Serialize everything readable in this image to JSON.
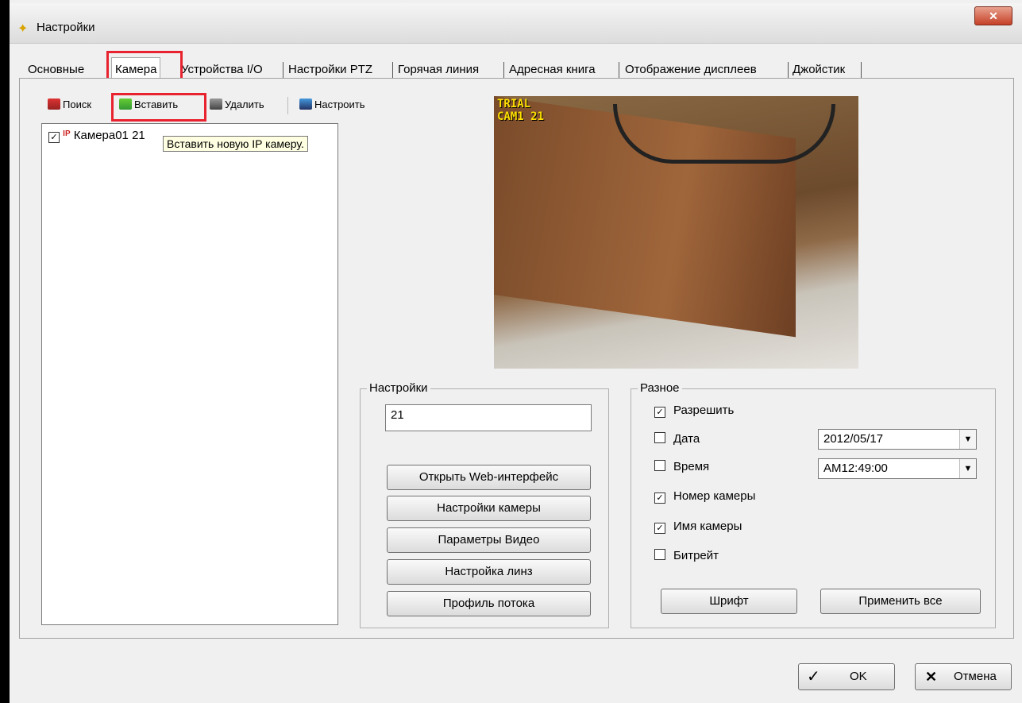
{
  "window": {
    "title": "Настройки"
  },
  "tabs": [
    {
      "label": "Основные"
    },
    {
      "label": "Камера"
    },
    {
      "label": "Устройства I/O"
    },
    {
      "label": "Настройки PTZ"
    },
    {
      "label": "Горячая линия"
    },
    {
      "label": "Адресная книга"
    },
    {
      "label": "Отображение дисплеев"
    },
    {
      "label": "Джойстик"
    }
  ],
  "toolbar": {
    "search_label": "Поиск",
    "insert_label": "Вставить",
    "delete_label": "Удалить",
    "configure_label": "Настроить"
  },
  "tree": {
    "item_label": "Камера01 21",
    "item_prefix": "IP"
  },
  "tooltip": "Вставить новую IP камеру.",
  "preview": {
    "overlay": "TRIAL\nCAM1 21"
  },
  "settings": {
    "title": "Настройки",
    "name_value": "21",
    "buttons": [
      "Открыть Web-интерфейс",
      "Настройки камеры",
      "Параметры Видео",
      "Настройка линз",
      "Профиль потока"
    ]
  },
  "misc": {
    "title": "Разное",
    "enable": {
      "label": "Разрешить",
      "checked": true
    },
    "date": {
      "label": "Дата",
      "checked": false,
      "value": "2012/05/17"
    },
    "time": {
      "label": "Время",
      "checked": false,
      "value": "AM12:49:00"
    },
    "camera_number": {
      "label": "Номер камеры",
      "checked": true
    },
    "camera_name": {
      "label": "Имя камеры",
      "checked": true
    },
    "bitrate": {
      "label": "Битрейт",
      "checked": false
    },
    "font_button": "Шрифт",
    "apply_all_button": "Применить все"
  },
  "footer": {
    "ok_label": "OK",
    "cancel_label": "Отмена"
  },
  "colors": {
    "highlight": "#e8222e",
    "overlay_text": "#ffe000",
    "close_button": "#c53f26"
  }
}
